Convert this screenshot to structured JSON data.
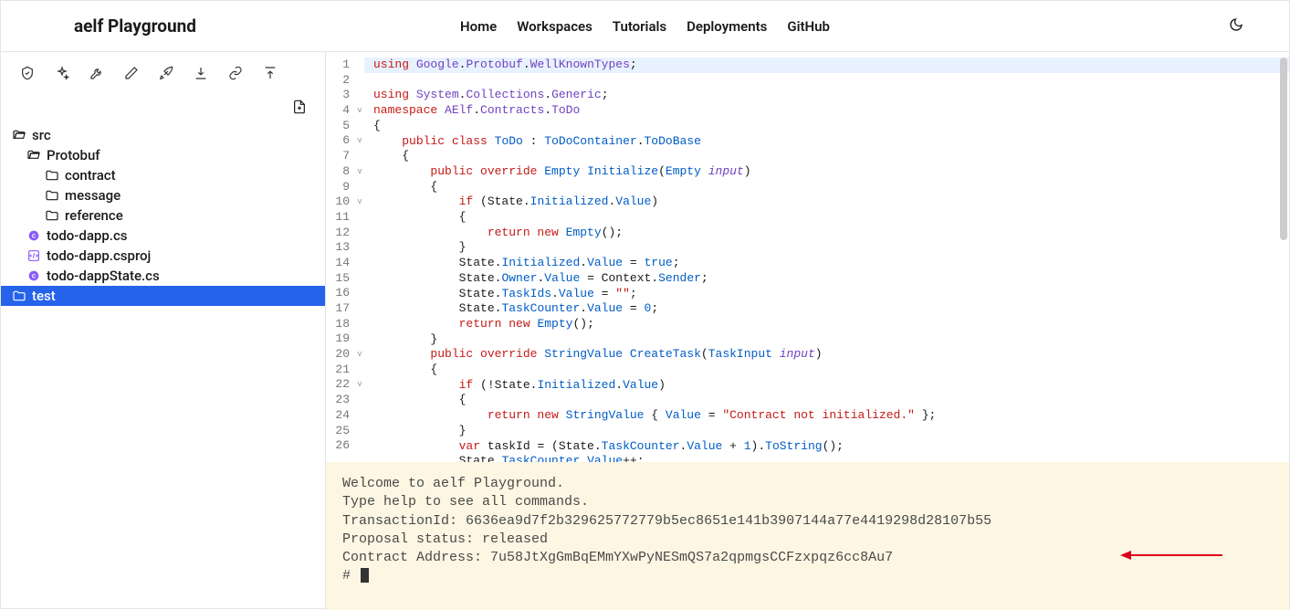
{
  "header": {
    "brand": "aelf Playground",
    "nav": [
      "Home",
      "Workspaces",
      "Tutorials",
      "Deployments",
      "GitHub"
    ]
  },
  "toolbar": {
    "icons": [
      "shield-check-icon",
      "sparkle-icon",
      "wrench-icon",
      "pencil-icon",
      "rocket-icon",
      "download-icon",
      "link-icon",
      "upload-icon"
    ]
  },
  "fileActions": {
    "newFile": "new-file-icon"
  },
  "tree": [
    {
      "label": "src",
      "icon": "folder-open-icon",
      "indent": 0,
      "selected": false
    },
    {
      "label": "Protobuf",
      "icon": "folder-open-icon",
      "indent": 1,
      "selected": false
    },
    {
      "label": "contract",
      "icon": "folder-icon",
      "indent": 2,
      "selected": false
    },
    {
      "label": "message",
      "icon": "folder-icon",
      "indent": 2,
      "selected": false
    },
    {
      "label": "reference",
      "icon": "folder-icon",
      "indent": 2,
      "selected": false
    },
    {
      "label": "todo-dapp.cs",
      "icon": "cs-file-icon",
      "indent": 1,
      "selected": false
    },
    {
      "label": "todo-dapp.csproj",
      "icon": "csproj-file-icon",
      "indent": 1,
      "selected": false
    },
    {
      "label": "todo-dappState.cs",
      "icon": "cs-file-icon",
      "indent": 1,
      "selected": false
    },
    {
      "label": "test",
      "icon": "folder-icon",
      "indent": 0,
      "selected": true
    }
  ],
  "editor": {
    "lineNumbers": [
      1,
      2,
      3,
      4,
      5,
      6,
      7,
      8,
      9,
      10,
      11,
      12,
      13,
      14,
      15,
      16,
      17,
      18,
      19,
      20,
      21,
      22,
      23,
      24,
      25,
      26
    ],
    "folds": {
      "4": "v",
      "6": "v",
      "8": "v",
      "10": "v",
      "20": "v",
      "22": "v"
    },
    "code": [
      {
        "tokens": [
          {
            "t": "using ",
            "c": "kw"
          },
          {
            "t": "Google",
            "c": "ns"
          },
          {
            "t": "."
          },
          {
            "t": "Protobuf",
            "c": "ns"
          },
          {
            "t": "."
          },
          {
            "t": "WellKnownTypes",
            "c": "ns"
          },
          {
            "t": ";"
          }
        ],
        "hl": true
      },
      {
        "tokens": [
          {
            "t": "using ",
            "c": "kw"
          },
          {
            "t": "System",
            "c": "ns"
          },
          {
            "t": "."
          },
          {
            "t": "Collections",
            "c": "ns"
          },
          {
            "t": "."
          },
          {
            "t": "Generic",
            "c": "ns"
          },
          {
            "t": ";"
          }
        ]
      },
      {
        "tokens": [
          {
            "t": "namespace ",
            "c": "kw"
          },
          {
            "t": "AElf",
            "c": "ns"
          },
          {
            "t": "."
          },
          {
            "t": "Contracts",
            "c": "ns"
          },
          {
            "t": "."
          },
          {
            "t": "ToDo",
            "c": "ns"
          }
        ]
      },
      {
        "tokens": [
          {
            "t": "{"
          }
        ]
      },
      {
        "tokens": [
          {
            "t": "    "
          },
          {
            "t": "public class ",
            "c": "kw"
          },
          {
            "t": "ToDo",
            "c": "ty"
          },
          {
            "t": " : "
          },
          {
            "t": "ToDoContainer",
            "c": "ty"
          },
          {
            "t": "."
          },
          {
            "t": "ToDoBase",
            "c": "ty"
          }
        ]
      },
      {
        "tokens": [
          {
            "t": "    {"
          }
        ]
      },
      {
        "tokens": [
          {
            "t": "        "
          },
          {
            "t": "public override ",
            "c": "kw"
          },
          {
            "t": "Empty",
            "c": "ty"
          },
          {
            "t": " "
          },
          {
            "t": "Initialize",
            "c": "fn"
          },
          {
            "t": "("
          },
          {
            "t": "Empty",
            "c": "ty"
          },
          {
            "t": " "
          },
          {
            "t": "input",
            "c": "va"
          },
          {
            "t": ")"
          }
        ]
      },
      {
        "tokens": [
          {
            "t": "        {"
          }
        ]
      },
      {
        "tokens": [
          {
            "t": "            "
          },
          {
            "t": "if ",
            "c": "kw"
          },
          {
            "t": "(State."
          },
          {
            "t": "Initialized",
            "c": "pr"
          },
          {
            "t": "."
          },
          {
            "t": "Value",
            "c": "pr"
          },
          {
            "t": ")"
          }
        ]
      },
      {
        "tokens": [
          {
            "t": "            {"
          }
        ]
      },
      {
        "tokens": [
          {
            "t": "                "
          },
          {
            "t": "return new ",
            "c": "kw"
          },
          {
            "t": "Empty",
            "c": "ty"
          },
          {
            "t": "();"
          }
        ]
      },
      {
        "tokens": [
          {
            "t": "            }"
          }
        ]
      },
      {
        "tokens": [
          {
            "t": "            State."
          },
          {
            "t": "Initialized",
            "c": "pr"
          },
          {
            "t": "."
          },
          {
            "t": "Value",
            "c": "pr"
          },
          {
            "t": " = "
          },
          {
            "t": "true",
            "c": "bl"
          },
          {
            "t": ";"
          }
        ]
      },
      {
        "tokens": [
          {
            "t": "            State."
          },
          {
            "t": "Owner",
            "c": "pr"
          },
          {
            "t": "."
          },
          {
            "t": "Value",
            "c": "pr"
          },
          {
            "t": " = Context."
          },
          {
            "t": "Sender",
            "c": "pr"
          },
          {
            "t": ";"
          }
        ]
      },
      {
        "tokens": [
          {
            "t": "            State."
          },
          {
            "t": "TaskIds",
            "c": "pr"
          },
          {
            "t": "."
          },
          {
            "t": "Value",
            "c": "pr"
          },
          {
            "t": " = "
          },
          {
            "t": "\"\"",
            "c": "st"
          },
          {
            "t": ";"
          }
        ]
      },
      {
        "tokens": [
          {
            "t": "            State."
          },
          {
            "t": "TaskCounter",
            "c": "pr"
          },
          {
            "t": "."
          },
          {
            "t": "Value",
            "c": "pr"
          },
          {
            "t": " = "
          },
          {
            "t": "0",
            "c": "nm"
          },
          {
            "t": ";"
          }
        ]
      },
      {
        "tokens": [
          {
            "t": "            "
          },
          {
            "t": "return new ",
            "c": "kw"
          },
          {
            "t": "Empty",
            "c": "ty"
          },
          {
            "t": "();"
          }
        ]
      },
      {
        "tokens": [
          {
            "t": "        }"
          }
        ]
      },
      {
        "tokens": [
          {
            "t": "        "
          },
          {
            "t": "public override ",
            "c": "kw"
          },
          {
            "t": "StringValue",
            "c": "ty"
          },
          {
            "t": " "
          },
          {
            "t": "CreateTask",
            "c": "fn"
          },
          {
            "t": "("
          },
          {
            "t": "TaskInput",
            "c": "ty"
          },
          {
            "t": " "
          },
          {
            "t": "input",
            "c": "va"
          },
          {
            "t": ")"
          }
        ]
      },
      {
        "tokens": [
          {
            "t": "        {"
          }
        ]
      },
      {
        "tokens": [
          {
            "t": "            "
          },
          {
            "t": "if ",
            "c": "kw"
          },
          {
            "t": "(!State."
          },
          {
            "t": "Initialized",
            "c": "pr"
          },
          {
            "t": "."
          },
          {
            "t": "Value",
            "c": "pr"
          },
          {
            "t": ")"
          }
        ]
      },
      {
        "tokens": [
          {
            "t": "            {"
          }
        ]
      },
      {
        "tokens": [
          {
            "t": "                "
          },
          {
            "t": "return new ",
            "c": "kw"
          },
          {
            "t": "StringValue",
            "c": "ty"
          },
          {
            "t": " { "
          },
          {
            "t": "Value",
            "c": "pr"
          },
          {
            "t": " = "
          },
          {
            "t": "\"Contract not initialized.\"",
            "c": "st"
          },
          {
            "t": " };"
          }
        ]
      },
      {
        "tokens": [
          {
            "t": "            }"
          }
        ]
      },
      {
        "tokens": [
          {
            "t": "            "
          },
          {
            "t": "var ",
            "c": "kw"
          },
          {
            "t": "taskId = (State."
          },
          {
            "t": "TaskCounter",
            "c": "pr"
          },
          {
            "t": "."
          },
          {
            "t": "Value",
            "c": "pr"
          },
          {
            "t": " + "
          },
          {
            "t": "1",
            "c": "nm"
          },
          {
            "t": ")."
          },
          {
            "t": "ToString",
            "c": "fn"
          },
          {
            "t": "();"
          }
        ]
      },
      {
        "tokens": [
          {
            "t": "            State."
          },
          {
            "t": "TaskCounter",
            "c": "pr"
          },
          {
            "t": "."
          },
          {
            "t": "Value",
            "c": "pr"
          },
          {
            "t": "++;"
          }
        ]
      }
    ]
  },
  "terminal": {
    "lines": [
      "Welcome to aelf Playground.",
      "Type help to see all commands.",
      "TransactionId: 6636ea9d7f2b329625772779b5ec8651e141b3907144a77e4419298d28107b55",
      "Proposal status: released",
      "Contract Address: 7u58JtXgGmBqEMmYXwPyNESmQS7a2qpmgsCCFzxpqz6cc8Au7"
    ],
    "prompt": "#"
  }
}
